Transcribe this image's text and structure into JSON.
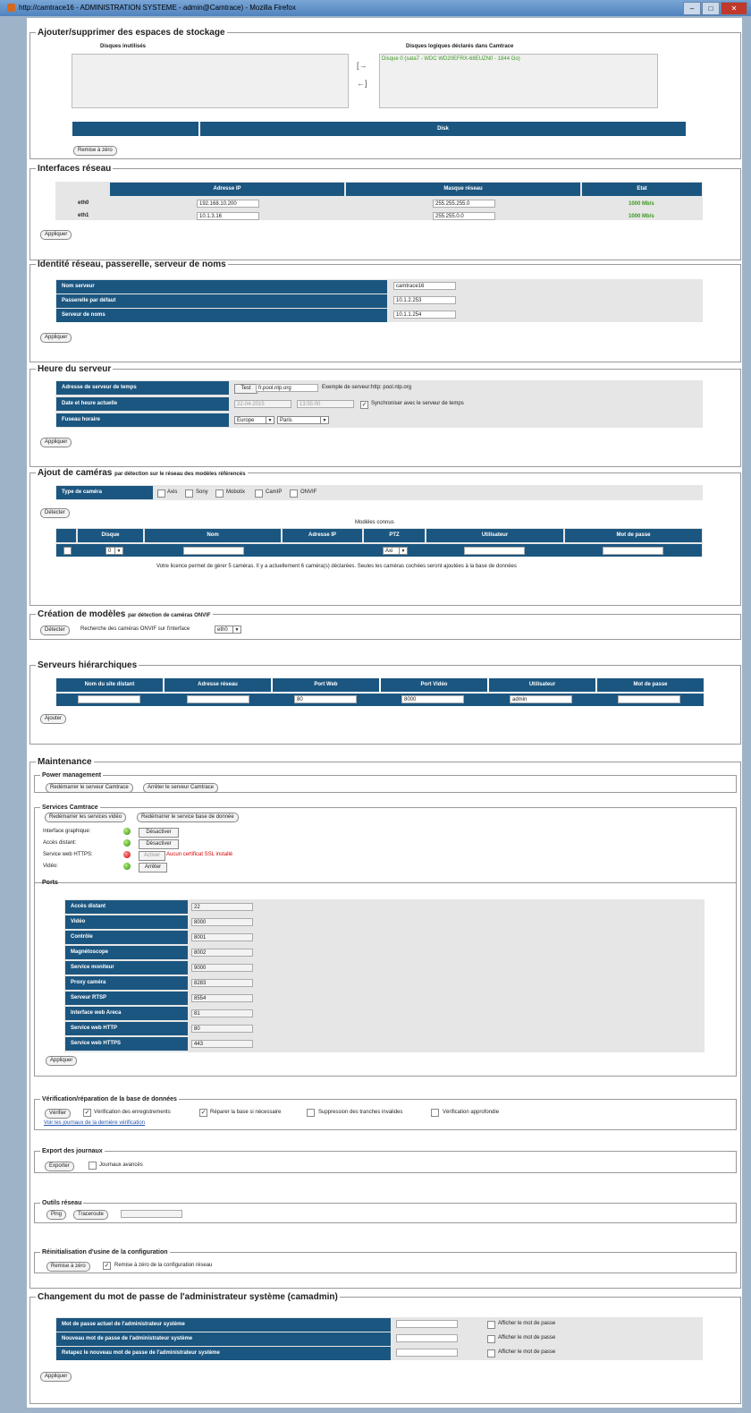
{
  "window": {
    "title": "http://camtrace16 - ADMINISTRATION SYSTEME - admin@Camtrace) - Mozilla Firefox"
  },
  "storage": {
    "legend": "Ajouter/supprimer des espaces de stockage",
    "unused_title": "Disques inutilisés",
    "declared_title": "Disques logiques déclarés dans Camtrace",
    "declared_item": "Disque 0 (sata7 - WDC WD20EFRX-68EUZN0 - 1844 Go)",
    "add_arrow": "[→",
    "remove_arrow": "←]",
    "table_header": "Disk",
    "reset_button": "Remise à zéro"
  },
  "network": {
    "legend": "Interfaces réseau",
    "headers": [
      "Adresse IP",
      "Masque réseau",
      "Etat"
    ],
    "rows": [
      {
        "name": "eth0",
        "ip": "192.168.10.200",
        "mask": "255.255.255.0",
        "state": "1000 Mb/s"
      },
      {
        "name": "eth1",
        "ip": "10.1.3.16",
        "mask": "255.255.0.0",
        "state": "1000 Mb/s"
      }
    ],
    "apply_button": "Appliquer"
  },
  "identity": {
    "legend": "Identité réseau, passerelle, serveur de noms",
    "rows": [
      {
        "label": "Nom serveur",
        "value": "camtrace16"
      },
      {
        "label": "Passerelle par défaut",
        "value": "10.1.2.253"
      },
      {
        "label": "Serveur de noms",
        "value": "10.1.1.254"
      }
    ],
    "apply_button": "Appliquer"
  },
  "time": {
    "legend": "Heure du serveur",
    "ntp_label": "Adresse de serveur de temps",
    "test_button": "Test",
    "ntp_value": "fr.pool.ntp.org",
    "ntp_example": "Exemple de serveur:http: pool.ntp.org",
    "date_label": "Date et heure actuelle",
    "date_value": "22-04-2015",
    "time_value": "13:55:00",
    "sync_label": "Synchroniser avec le serveur de temps",
    "tz_label": "Fuseau horaire",
    "tz_region": "Europe",
    "tz_city": "Paris",
    "apply_button": "Appliquer"
  },
  "cameras": {
    "legend": "Ajout de caméras",
    "legend_small": "par détection sur le réseau des modèles référencés",
    "type_label": "Type de caméra",
    "types": [
      "Axis",
      "Sony",
      "Mobotix",
      "CamIP",
      "ONVIF"
    ],
    "detect_button": "Détecter",
    "known_title": "Modèles connus",
    "headers": [
      "Disque",
      "Nom",
      "Adresse IP",
      "PTZ",
      "Utilisateur",
      "Mot de passe"
    ],
    "row": {
      "disk": "0",
      "ptz": "Axi"
    },
    "license_text": "Votre licence permet de gérer 5 caméras. Il y a actuellement 6 caméra(s) déclarées. Seules les caméras cochées seront ajoutées à la base de données"
  },
  "models": {
    "legend": "Création de modèles",
    "legend_small": "par détection de caméras ONVIF",
    "detect_button": "Détecter",
    "search_text": "Recherche des caméras ONVIF sur l'interface",
    "iface": "eth0"
  },
  "hier": {
    "legend": "Serveurs hiérarchiques",
    "headers": [
      "Nom du site distant",
      "Adresse réseau",
      "Port Web",
      "Port Vidéo",
      "Utilisateur",
      "Mot de passe"
    ],
    "row": [
      "",
      "",
      "80",
      "8000",
      "admin",
      ""
    ],
    "add_button": "Ajouter"
  },
  "maint": {
    "legend": "Maintenance",
    "power": {
      "legend": "Power management",
      "restart": "Redémarrer le serveur Camtrace",
      "stop": "Arrêter le serveur Camtrace"
    },
    "services": {
      "legend": "Services Camtrace",
      "restart_video": "Redémarrer les services vidéo",
      "restart_db": "Redémarrer le service base de donnée",
      "items": [
        {
          "label": "Interface graphique:",
          "button": "Désactiver",
          "status": "green"
        },
        {
          "label": "Accès distant:",
          "button": "Désactiver",
          "status": "green"
        },
        {
          "label": "Service web HTTPS:",
          "button": "Activer",
          "status": "red",
          "note": "Aucun certificat SSL installé"
        },
        {
          "label": "Vidéo:",
          "button": "Arrêter",
          "status": "green"
        }
      ]
    },
    "ports": {
      "legend": "Ports",
      "rows": [
        {
          "label": "Accès distant",
          "value": "22"
        },
        {
          "label": "Vidéo",
          "value": "8000"
        },
        {
          "label": "Contrôle",
          "value": "8001"
        },
        {
          "label": "Magnétoscope",
          "value": "8002"
        },
        {
          "label": "Service moniteur",
          "value": "9000"
        },
        {
          "label": "Proxy caméra",
          "value": "8283"
        },
        {
          "label": "Serveur RTSP",
          "value": "8554"
        },
        {
          "label": "Interface web Areca",
          "value": "81"
        },
        {
          "label": "Service web HTTP",
          "value": "80"
        },
        {
          "label": "Service web HTTPS",
          "value": "443"
        }
      ],
      "apply_button": "Appliquer"
    },
    "verify": {
      "legend": "Vérification/réparation de la base de données",
      "button": "Vérifier",
      "options": [
        "Vérification des enregistrements",
        "Réparer la base si nécessaire",
        "Suppression des tranches invalides",
        "Vérification approfondie"
      ],
      "link": "Voir les journaux de la dernière vérification"
    },
    "export": {
      "legend": "Export des journaux",
      "button": "Exporter",
      "option": "Journaux avancés"
    },
    "tools": {
      "legend": "Outils réseau",
      "ping": "Ping",
      "trace": "Traceroute"
    },
    "reset": {
      "legend": "Réinitialisation d'usine de la configuration",
      "button": "Remise à zéro",
      "option": "Remise à zéro de la configuration réseau"
    }
  },
  "password": {
    "legend": "Changement du mot de passe de l'administrateur système (camadmin)",
    "rows": [
      "Mot de passe actuel de l'administrateur système",
      "Nouveau mot de passe de l'administrateur système",
      "Retapez le nouveau mot de passe de l'administrateur système"
    ],
    "show_label": "Afficher le mot de passe",
    "apply_button": "Appliquer"
  }
}
